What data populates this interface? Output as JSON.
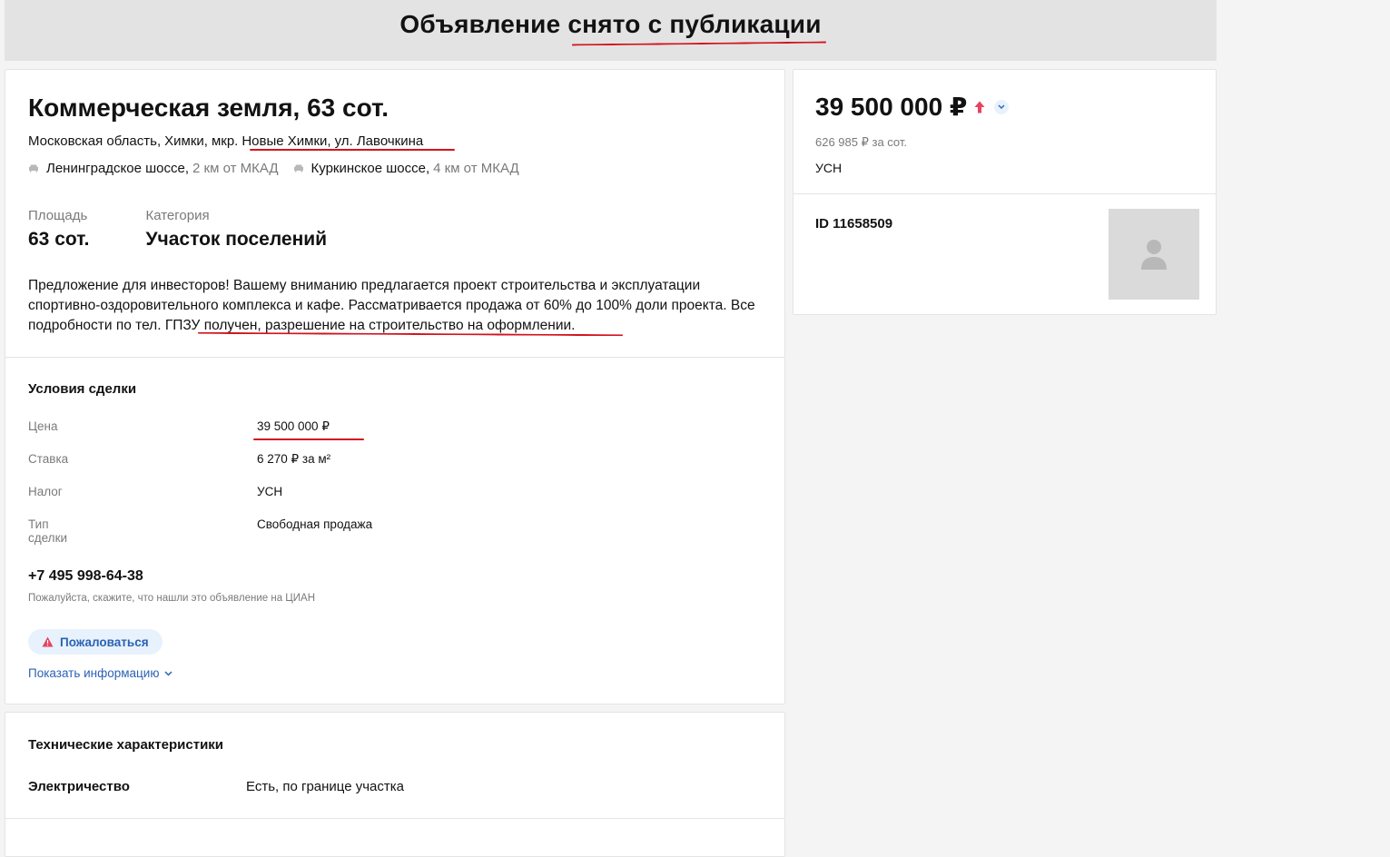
{
  "banner": {
    "title": "Объявление снято с публикации"
  },
  "offer": {
    "title": "Коммерческая земля, 63 сот.",
    "address": [
      "Московская область,",
      "Химки,",
      "мкр.",
      "Новые Химки,",
      "ул. Лавочкина"
    ],
    "highways": [
      {
        "name": "Ленинградское шоссе,",
        "distance": "2 км от МКАД",
        "icon": "car-icon"
      },
      {
        "name": "Куркинское шоссе,",
        "distance": "4 км от МКАД",
        "icon": "car-icon"
      }
    ],
    "facts": [
      {
        "label": "Площадь",
        "value": "63 сот."
      },
      {
        "label": "Категория",
        "value": "Участок поселений"
      }
    ],
    "description": "Предложение для инвесторов! Вашему вниманию предлагается проект строительства и эксплуатации спортивно-оздоровительного комплекса и кафе. Рассматривается продажа от 60% до 100% доли проекта. Все подробности по тел. ГПЗУ получен, разрешение на строительство на оформлении."
  },
  "deal": {
    "title": "Условия сделки",
    "rows": [
      {
        "label": "Цена",
        "value": "39 500 000 ₽"
      },
      {
        "label": "Ставка",
        "value": "6 270 ₽ за м²"
      },
      {
        "label": "Налог",
        "value": "УСН"
      },
      {
        "label": "Тип сделки",
        "value": "Свободная продажа"
      }
    ]
  },
  "contact": {
    "phone": "+7 495 998-64-38",
    "hint": "Пожалуйста, скажите, что нашли это объявление на ЦИАН",
    "complain_label": "Пожаловаться",
    "show_info_label": "Показать информацию"
  },
  "tech": {
    "title": "Технические характеристики",
    "rows": [
      {
        "label": "Электричество",
        "value": "Есть, по границе участка"
      }
    ]
  },
  "side": {
    "price": "39 500 000 ₽",
    "per_sot": "626 985 ₽ за сот.",
    "tax": "УСН",
    "id": "ID 11658509"
  },
  "colors": {
    "accent": "#2b62b5",
    "annotation": "#d2141e",
    "price_up": "#e84260"
  }
}
